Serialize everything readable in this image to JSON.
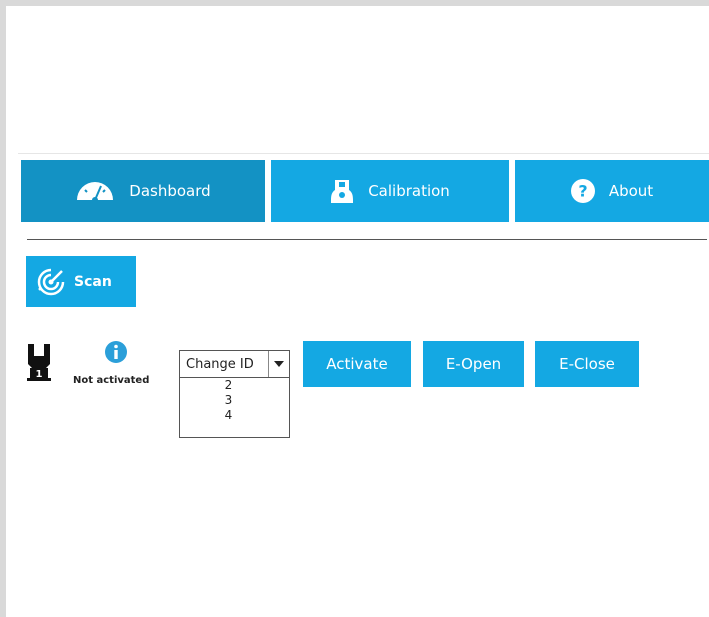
{
  "tabs": [
    {
      "label": "Dashboard",
      "icon": "dashboard-gauge-icon"
    },
    {
      "label": "Calibration",
      "icon": "calibration-icon"
    },
    {
      "label": "About",
      "icon": "help-question-icon"
    }
  ],
  "scan": {
    "label": "Scan",
    "icon": "scan-radar-icon"
  },
  "gripper": {
    "icon": "gripper-icon",
    "id_badge": "1",
    "status_icon": "info-icon",
    "status_text": "Not activated"
  },
  "id_select": {
    "value": "Change ID",
    "options": [
      "2",
      "3",
      "4"
    ]
  },
  "actions": {
    "activate": "Activate",
    "e_open": "E-Open",
    "e_close": "E-Close"
  },
  "colors": {
    "active_tab": "#1392c4",
    "primary": "#14a8e3",
    "text_on_primary": "#ffffff"
  }
}
